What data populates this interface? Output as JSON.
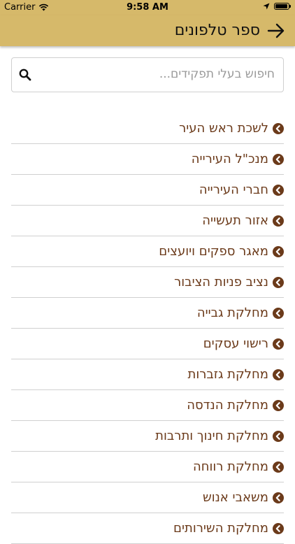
{
  "status_bar": {
    "carrier": "Carrier",
    "time": "9:58 AM",
    "battery_level": 0.95
  },
  "header": {
    "title": "ספר טלפונים",
    "back_icon": "arrow-right-icon",
    "background": "#d6b96a"
  },
  "search": {
    "placeholder": "חיפוש בעלי תפקידים...",
    "icon": "search-icon"
  },
  "list": {
    "item_color": "#6b3a1a",
    "items": [
      {
        "label": "לשכת ראש העיר"
      },
      {
        "label": "מנכ\"ל העירייה"
      },
      {
        "label": "חברי העירייה"
      },
      {
        "label": "אזור תעשייה"
      },
      {
        "label": "מאגר ספקים ויועצים"
      },
      {
        "label": "נציב פניות הציבור"
      },
      {
        "label": "מחלקת גבייה"
      },
      {
        "label": "רישוי עסקים"
      },
      {
        "label": "מחלקת גזברות"
      },
      {
        "label": "מחלקת הנדסה"
      },
      {
        "label": "מחלקת חינוך ותרבות"
      },
      {
        "label": "מחלקת רווחה"
      },
      {
        "label": "משאבי אנוש"
      },
      {
        "label": "מחלקת השירותים"
      }
    ]
  }
}
